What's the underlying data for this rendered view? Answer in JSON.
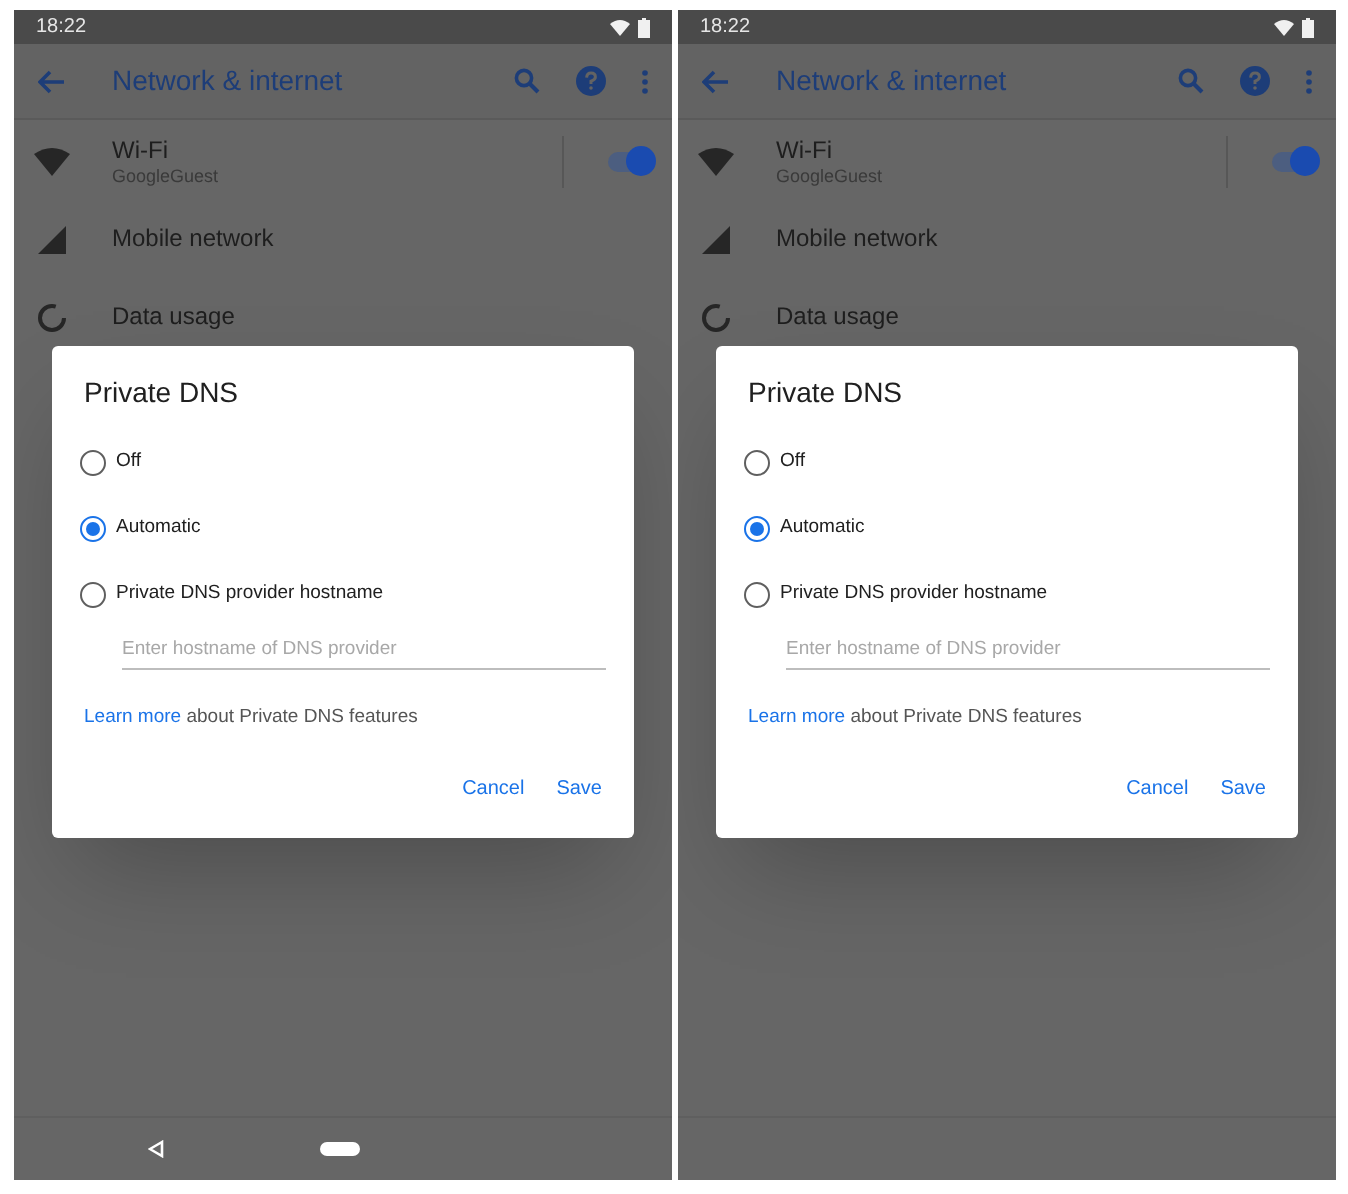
{
  "screens": [
    {
      "status_bar": {
        "time": "18:22"
      },
      "app_bar": {
        "title": "Network & internet"
      },
      "settings": [
        {
          "kind": "wifi",
          "title": "Wi-Fi",
          "subtitle": "GoogleGuest",
          "on": true
        },
        {
          "kind": "mobile",
          "title": "Mobile network"
        },
        {
          "kind": "data",
          "title": "Data usage"
        }
      ],
      "dialog": {
        "title": "Private DNS",
        "options": [
          {
            "label": "Off",
            "selected": false
          },
          {
            "label": "Automatic",
            "selected": true
          },
          {
            "label": "Private DNS provider hostname",
            "selected": false
          }
        ],
        "hostname_field": {
          "placeholder": "Enter hostname of DNS provider"
        },
        "learn_more": {
          "link": "Learn more",
          "text": "about Private DNS features"
        },
        "buttons": [
          "Cancel",
          "Save"
        ]
      },
      "nav_bar": {
        "buttons_shown": true
      }
    },
    {
      "status_bar": {
        "time": "18:22"
      },
      "app_bar": {
        "title": "Network & internet"
      },
      "settings": [
        {
          "kind": "wifi",
          "title": "Wi-Fi",
          "subtitle": "GoogleGuest",
          "on": true
        },
        {
          "kind": "mobile",
          "title": "Mobile network"
        },
        {
          "kind": "data",
          "title": "Data usage"
        }
      ],
      "dialog": {
        "title": "Private DNS",
        "options": [
          {
            "label": "Off",
            "selected": false
          },
          {
            "label": "Automatic",
            "selected": true
          },
          {
            "label": "Private DNS provider hostname",
            "selected": false
          }
        ],
        "hostname_field": {
          "placeholder": "Enter hostname of DNS provider"
        },
        "learn_more": {
          "link": "Learn more",
          "text": "about Private DNS features"
        },
        "buttons": [
          "Cancel",
          "Save"
        ]
      },
      "nav_bar": {
        "buttons_shown": false
      }
    }
  ]
}
